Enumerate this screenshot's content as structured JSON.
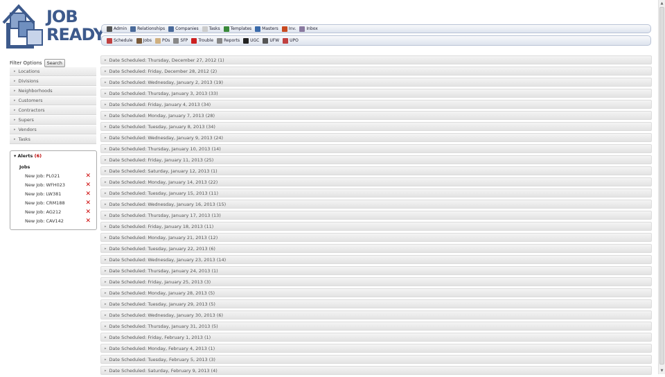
{
  "logo": {
    "line1": "JOB",
    "line2": "READY"
  },
  "nav_row1": [
    {
      "label": "Admin",
      "icon": "clipboard-icon",
      "color": "#555555"
    },
    {
      "label": "Relationships",
      "icon": "people-icon",
      "color": "#4a6a9a"
    },
    {
      "label": "Companies",
      "icon": "buildings-icon",
      "color": "#4a6a9a"
    },
    {
      "label": "Tasks",
      "icon": "task-list-icon",
      "color": "#cccccc"
    },
    {
      "label": "Templates",
      "icon": "grid-icon",
      "color": "#3a8a3a"
    },
    {
      "label": "Masters",
      "icon": "folder-icon",
      "color": "#3a6aaa"
    },
    {
      "label": "Inv.",
      "icon": "box-icon",
      "color": "#c84a20"
    },
    {
      "label": "Inbox",
      "icon": "inbox-icon",
      "color": "#8a7aa0"
    }
  ],
  "nav_row2": [
    {
      "label": "Schedule",
      "icon": "calendar-icon",
      "color": "#c04040"
    },
    {
      "label": "Jobs",
      "icon": "briefcase-icon",
      "color": "#7a5a3a"
    },
    {
      "label": "POs",
      "icon": "document-icon",
      "color": "#d0b080"
    },
    {
      "label": "SFP",
      "icon": "truck-icon",
      "color": "#888888"
    },
    {
      "label": "Trouble",
      "icon": "alert-pin-icon",
      "color": "#cc2020"
    },
    {
      "label": "Reports",
      "icon": "wrench-icon",
      "color": "#888888"
    },
    {
      "label": "UGC",
      "icon": "phone-icon",
      "color": "#222222"
    },
    {
      "label": "UFW",
      "icon": "clipboard-check-icon",
      "color": "#555555"
    },
    {
      "label": "UPO",
      "icon": "warning-doc-icon",
      "color": "#c04040"
    }
  ],
  "filter": {
    "label": "Filter Options",
    "search_button": "Search"
  },
  "filters": [
    "Locations",
    "Divisions",
    "Neighborhoods",
    "Customers",
    "Contractors",
    "Supers",
    "Vendors",
    "Tasks"
  ],
  "alerts": {
    "title": "Alerts",
    "count": "(6)",
    "group": "Jobs",
    "items": [
      "New Job: PL021",
      "New Job: WFH023",
      "New Job: LW381",
      "New Job: CRM188",
      "New Job: AG212",
      "New Job: CAV142"
    ]
  },
  "schedule": [
    "Date Scheduled: Thursday, December 27, 2012 (1)",
    "Date Scheduled: Friday, December 28, 2012 (2)",
    "Date Scheduled: Wednesday, January 2, 2013 (19)",
    "Date Scheduled: Thursday, January 3, 2013 (33)",
    "Date Scheduled: Friday, January 4, 2013 (34)",
    "Date Scheduled: Monday, January 7, 2013 (28)",
    "Date Scheduled: Tuesday, January 8, 2013 (34)",
    "Date Scheduled: Wednesday, January 9, 2013 (24)",
    "Date Scheduled: Thursday, January 10, 2013 (14)",
    "Date Scheduled: Friday, January 11, 2013 (25)",
    "Date Scheduled: Saturday, January 12, 2013 (1)",
    "Date Scheduled: Monday, January 14, 2013 (22)",
    "Date Scheduled: Tuesday, January 15, 2013 (11)",
    "Date Scheduled: Wednesday, January 16, 2013 (15)",
    "Date Scheduled: Thursday, January 17, 2013 (13)",
    "Date Scheduled: Friday, January 18, 2013 (11)",
    "Date Scheduled: Monday, January 21, 2013 (12)",
    "Date Scheduled: Tuesday, January 22, 2013 (6)",
    "Date Scheduled: Wednesday, January 23, 2013 (14)",
    "Date Scheduled: Thursday, January 24, 2013 (1)",
    "Date Scheduled: Friday, January 25, 2013 (3)",
    "Date Scheduled: Monday, January 28, 2013 (5)",
    "Date Scheduled: Tuesday, January 29, 2013 (5)",
    "Date Scheduled: Wednesday, January 30, 2013 (6)",
    "Date Scheduled: Thursday, January 31, 2013 (5)",
    "Date Scheduled: Friday, February 1, 2013 (1)",
    "Date Scheduled: Monday, February 4, 2013 (1)",
    "Date Scheduled: Tuesday, February 5, 2013 (3)",
    "Date Scheduled: Saturday, February 9, 2013 (4)"
  ]
}
